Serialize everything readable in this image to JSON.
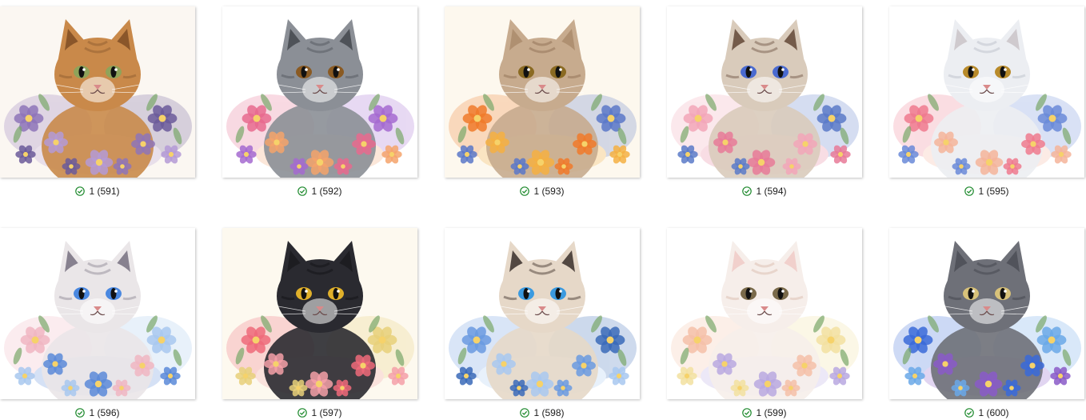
{
  "files": [
    {
      "name": "1 (591)",
      "status_icon": "sync-check-icon",
      "subject": "maine-coon-lavender",
      "palette": {
        "bg": "#fbf7f2",
        "fur": "#c9894a",
        "fur2": "#8a5a2e",
        "ear": "#7a4a22",
        "eye": "#8fa35a",
        "flower1": "#8e74b8",
        "flower2": "#b49ad6",
        "flower3": "#6b5a9a"
      }
    },
    {
      "name": "1 (592)",
      "status_icon": "sync-check-icon",
      "subject": "tabby-pink-flowers",
      "palette": {
        "bg": "#ffffff",
        "fur": "#8b8f96",
        "fur2": "#4f535a",
        "ear": "#3f4248",
        "eye": "#8a5a22",
        "flower1": "#e76a8e",
        "flower2": "#f4a36b",
        "flower3": "#a46ad0"
      }
    },
    {
      "name": "1 (593)",
      "status_icon": "sync-check-icon",
      "subject": "scottish-orange-flowers",
      "palette": {
        "bg": "#fdf8ee",
        "fur": "#c7ab8e",
        "fur2": "#8a6a4e",
        "ear": "#a98a6a",
        "eye": "#8a6a22",
        "flower1": "#f07a2a",
        "flower2": "#f4b042",
        "flower3": "#5a78c8"
      }
    },
    {
      "name": "1 (594)",
      "status_icon": "sync-check-icon",
      "subject": "ragdoll-pink-flowers",
      "palette": {
        "bg": "#ffffff",
        "fur": "#d9cbbb",
        "fur2": "#6b5040",
        "ear": "#5a3e2e",
        "eye": "#4a6ad0",
        "flower1": "#f2a6b8",
        "flower2": "#e77a98",
        "flower3": "#5a7ac8"
      }
    },
    {
      "name": "1 (595)",
      "status_icon": "sync-check-icon",
      "subject": "white-persian-flowers",
      "palette": {
        "bg": "#ffffff",
        "fur": "#eceef2",
        "fur2": "#b8bcc6",
        "ear": "#c8c0c4",
        "eye": "#b88a2a",
        "flower1": "#ef7a8e",
        "flower2": "#f4b49a",
        "flower3": "#6a8ad8"
      }
    },
    {
      "name": "1 (596)",
      "status_icon": "sync-check-icon",
      "subject": "ragdoll-blue-roses",
      "palette": {
        "bg": "#ffffff",
        "fur": "#eae6e8",
        "fur2": "#8a8490",
        "ear": "#6e6878",
        "eye": "#4a88e0",
        "flower1": "#f0b6c2",
        "flower2": "#5a8ad8",
        "flower3": "#a8c8ee"
      }
    },
    {
      "name": "1 (597)",
      "status_icon": "sync-check-icon",
      "subject": "black-cat-pink-flowers",
      "palette": {
        "bg": "#fdf9ef",
        "fur": "#2a2a30",
        "fur2": "#111114",
        "ear": "#1a1a1e",
        "eye": "#e0b02a",
        "flower1": "#ef6a7a",
        "flower2": "#f4a0a8",
        "flower3": "#e8d07a"
      }
    },
    {
      "name": "1 (598)",
      "status_icon": "sync-check-icon",
      "subject": "siamese-blue-flowers",
      "palette": {
        "bg": "#ffffff",
        "fur": "#e6d8c8",
        "fur2": "#3a2c26",
        "ear": "#2e2420",
        "eye": "#3a9ae0",
        "flower1": "#6a9ae0",
        "flower2": "#a8c8f0",
        "flower3": "#3a6ab8"
      }
    },
    {
      "name": "1 (599)",
      "status_icon": "sync-check-icon",
      "subject": "white-kitten-pastel-flowers",
      "palette": {
        "bg": "#ffffff",
        "fur": "#f6eeea",
        "fur2": "#d8b8a8",
        "ear": "#f0c8c4",
        "eye": "#7a6a4a",
        "flower1": "#f4c0a8",
        "flower2": "#b8a8e0",
        "flower3": "#f2e0a0"
      }
    },
    {
      "name": "1 (600)",
      "status_icon": "sync-check-icon",
      "subject": "gray-cat-blue-flowers",
      "palette": {
        "bg": "#ffffff",
        "fur": "#6e7078",
        "fur2": "#3e4048",
        "ear": "#4a4c54",
        "eye": "#d8c27a",
        "flower1": "#3a6ad8",
        "flower2": "#8a5ac8",
        "flower3": "#6aa8e8"
      }
    }
  ],
  "colors": {
    "check": "#1f8a2e",
    "caption_text": "#1b1b1b"
  }
}
